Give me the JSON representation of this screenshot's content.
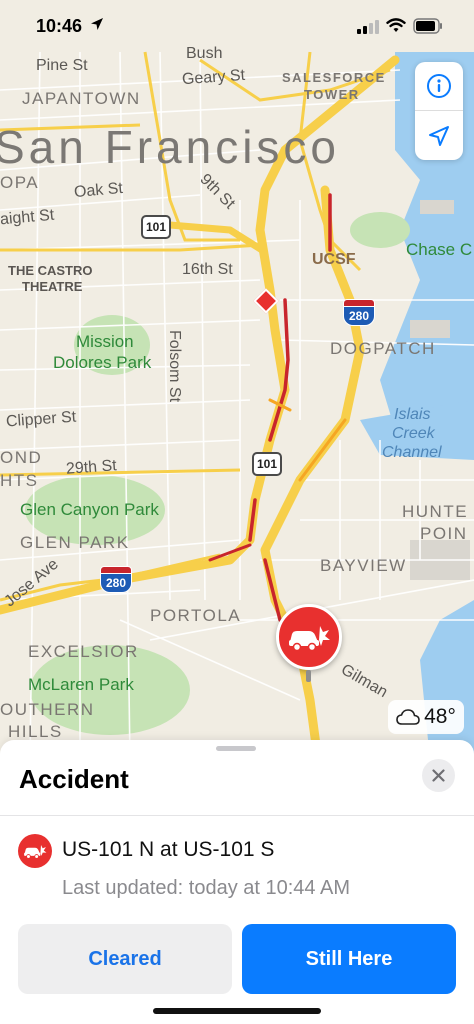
{
  "status_bar": {
    "time": "10:46",
    "icons": [
      "location-arrow-icon",
      "cellular-signal-icon",
      "wifi-icon",
      "battery-icon"
    ]
  },
  "map": {
    "city": "San Francisco",
    "areas": [
      "JAPANTOWN",
      "SALESFORCE",
      "TOWER",
      "OPA",
      "DOGPATCH",
      "OND",
      "HTS",
      "GLEN PARK",
      "BAYVIEW",
      "HUNTE",
      "POIN",
      "PORTOLA",
      "EXCELSIOR",
      "OUTHERN",
      "HILLS"
    ],
    "streets": [
      "Pine St",
      "Bush",
      "Geary St",
      "Oak St",
      "aight St",
      "9th St",
      "16th St",
      "Folsom St",
      "Clipper St",
      "29th St",
      "Jose Ave",
      "Gilman"
    ],
    "parks": [
      "Mission",
      "Dolores Park",
      "Glen Canyon Park",
      "McLaren Park"
    ],
    "pois": [
      "UCSF",
      "Chase C",
      "THE CASTRO",
      "THEATRE"
    ],
    "water": [
      "Islais",
      "Creek",
      "Channel"
    ],
    "shields": {
      "us101_a": "101",
      "us101_b": "101",
      "i280_a": "280",
      "i280_b": "280"
    },
    "weather": {
      "temp": "48°",
      "icon": "cloud-icon"
    },
    "controls": [
      "info-icon",
      "location-arrow-icon"
    ],
    "colors": {
      "traffic_heavy": "#c8252c",
      "traffic_slow": "#f5a623",
      "highway": "#f7cf4a",
      "incident": "#e8302f"
    }
  },
  "sheet": {
    "title": "Accident",
    "location": "US-101 N at US-101 S",
    "updated": "Last updated: today at 10:44 AM",
    "buttons": {
      "cleared": "Cleared",
      "still_here": "Still Here"
    }
  }
}
